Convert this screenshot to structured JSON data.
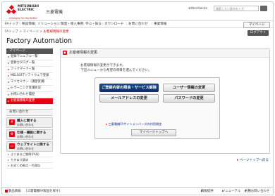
{
  "header": {
    "logo_line1": "MITSUBISHI",
    "logo_line2": "ELECTRIC",
    "logo_tagline": "Changes for the Better",
    "brand_ja": "三菱電機",
    "worldwide": "Worldwide",
    "search_placeholder": "検索したい語句を入力"
  },
  "nav": {
    "items": [
      "FAトップ",
      "製品情報",
      "ソリューション",
      "関連・導入事例",
      "学ぶ・知る",
      "ダウンロード",
      "お問い合わせ",
      "事業情報"
    ],
    "mypage": "マイページ"
  },
  "breadcrumb": {
    "items": [
      "FAトップ",
      "マイページ"
    ],
    "current": "お客様情報の変更"
  },
  "logout": "ログアウト",
  "site_title": "Factory Automation",
  "sidebar": {
    "heading": "マイページ",
    "items": [
      {
        "label": "登録マニュアル一覧"
      },
      {
        "label": "登録カタログ一覧"
      },
      {
        "label": "ブックマーク一覧"
      },
      {
        "label": "MELSOFTソフトウェア登録"
      },
      {
        "label": "マイセミナー（講習受講）"
      },
      {
        "label": "e-ラーニング受講状況"
      },
      {
        "label": "お問い合わせ履歴"
      },
      {
        "label": "お客様情報の変更",
        "active": true
      }
    ],
    "contact_heading": "お問い合わせ",
    "contact_buttons": [
      {
        "line1": "購入に関する",
        "line2": "お問い合わせ",
        "icon": "cart-icon"
      },
      {
        "line1": "仕様・機能に関する",
        "line2": "お問い合わせ",
        "icon": "gear-icon"
      },
      {
        "line1": "ウェブサイトに関する",
        "line2": "お問い合わせ",
        "icon": "monitor-icon"
      }
    ],
    "links": [
      "よくあるご質問(FAQ)",
      "カタログ請求",
      "お近くの拠点・代理店"
    ]
  },
  "main": {
    "title": "お客様情報の変更",
    "desc_line1": "お客様情報の変更ができます。",
    "desc_line2": "下記メニューから希望の項目を選んでください。",
    "buttons": {
      "info_service": "ご登録内容の照会・サービス解除",
      "user_info": "ユーザー情報の変更",
      "email": "メールアドレスの変更",
      "password": "パスワードの変更"
    },
    "terms_link": "三菱電機FAサイトメンバーズの利用規定",
    "back_button": "マイページトップへ"
  },
  "page_top": "ページトップへ戻る",
  "footer": {
    "site_info": "製品情報",
    "notice": "[三菱電機FA製品を探す]",
    "links": [
      "情報提供",
      "リニューアル",
      "各種お問い合わせ"
    ]
  },
  "colors": {
    "accent": "#e60012",
    "nav_active": "#0b2f66",
    "link": "#0a2f8c"
  }
}
